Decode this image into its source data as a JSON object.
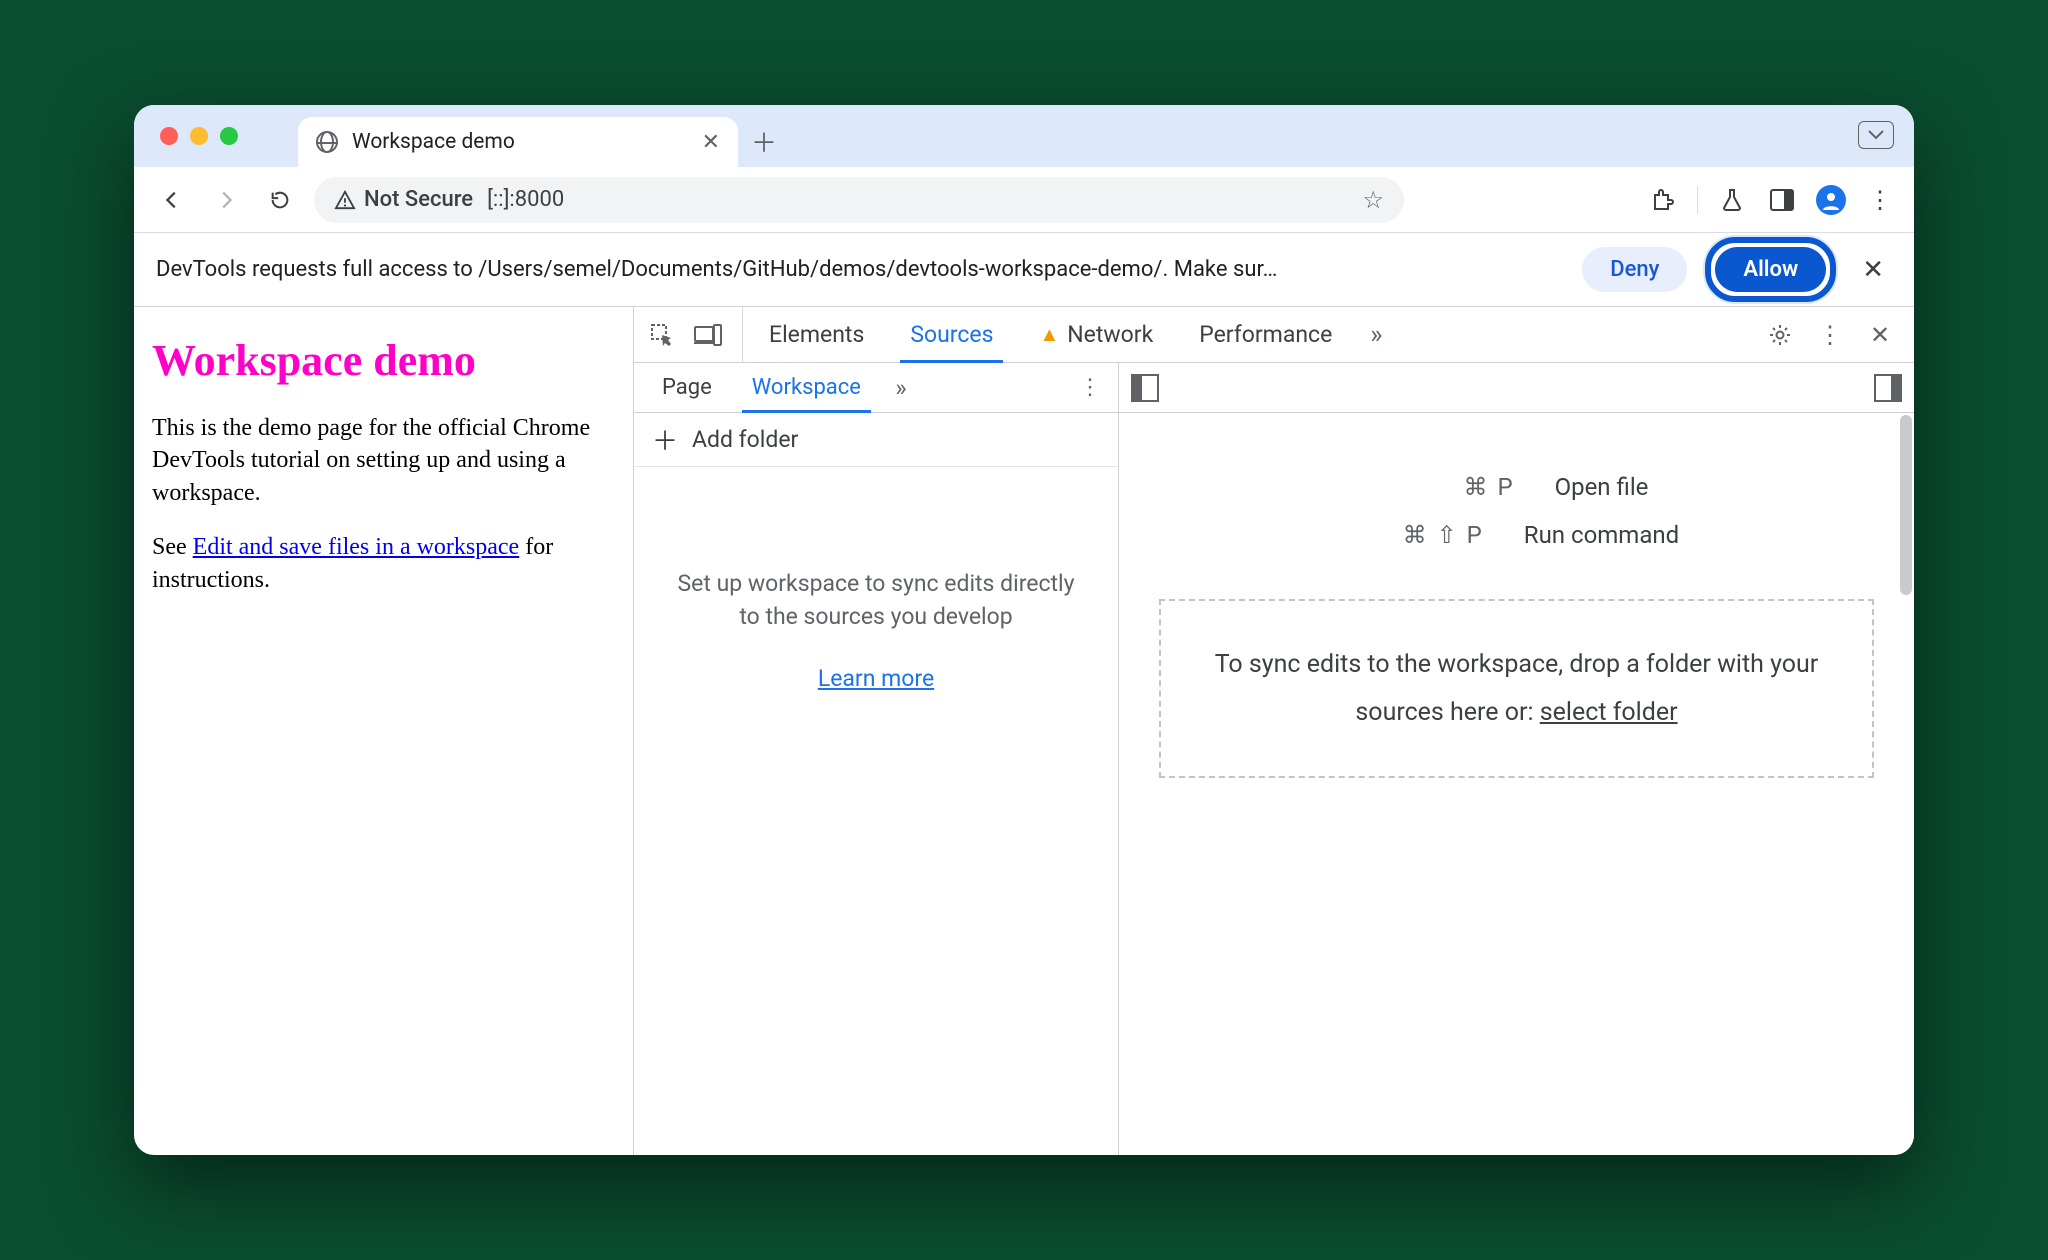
{
  "browser": {
    "tab_title": "Workspace demo",
    "omnibox": {
      "security_label": "Not Secure",
      "url": "[::]:8000"
    }
  },
  "infobar": {
    "message": "DevTools requests full access to /Users/semel/Documents/GitHub/demos/devtools-workspace-demo/. Make sur…",
    "deny": "Deny",
    "allow": "Allow"
  },
  "page": {
    "heading": "Workspace demo",
    "p1": "This is the demo page for the official Chrome DevTools tutorial on setting up and using a workspace.",
    "p2_prefix": "See ",
    "p2_link": "Edit and save files in a workspace",
    "p2_suffix": " for instructions."
  },
  "devtools": {
    "tabs": {
      "elements": "Elements",
      "sources": "Sources",
      "network": "Network",
      "performance": "Performance"
    },
    "left": {
      "tabs": {
        "page": "Page",
        "workspace": "Workspace"
      },
      "add_folder": "Add folder",
      "empty_msg": "Set up workspace to sync edits directly to the sources you develop",
      "learn_more": "Learn more"
    },
    "right": {
      "open_file_keys": "⌘ P",
      "open_file_label": "Open file",
      "run_cmd_keys": "⌘ ⇧ P",
      "run_cmd_label": "Run command",
      "drop_text": "To sync edits to the workspace, drop a folder with your sources here or: ",
      "select_folder": "select folder"
    }
  }
}
